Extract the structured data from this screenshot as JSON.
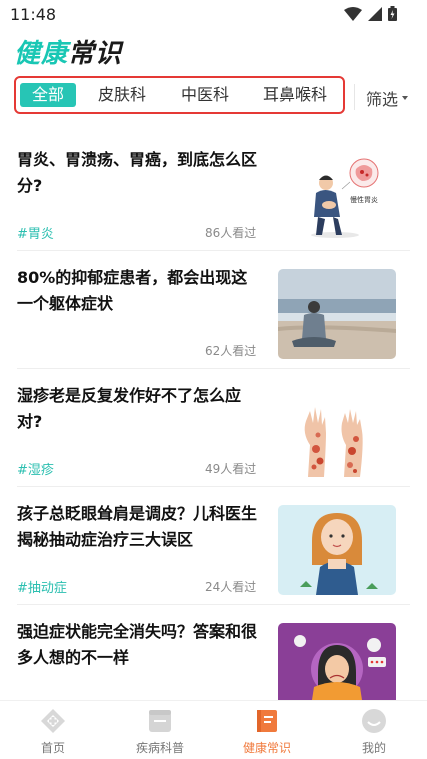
{
  "status_bar": {
    "time": "11:48"
  },
  "header": {
    "title_part1": "健康",
    "title_part2": "常识"
  },
  "tabs": [
    {
      "label": "全部",
      "active": true
    },
    {
      "label": "皮肤科",
      "active": false
    },
    {
      "label": "中医科",
      "active": false
    },
    {
      "label": "耳鼻喉科",
      "active": false
    }
  ],
  "filter": {
    "label": "筛选"
  },
  "articles": [
    {
      "title": "胃炎、胃溃疡、胃癌，到底怎么区分?",
      "tag": "#胃炎",
      "views": "86人看过",
      "thumb_text": "慢性胃炎"
    },
    {
      "title": "80%的抑郁症患者，都会出现这一个躯体症状",
      "tag": "",
      "views": "62人看过"
    },
    {
      "title": "湿疹老是反复发作好不了怎么应对?",
      "tag": "#湿疹",
      "views": "49人看过"
    },
    {
      "title": "孩子总眨眼耸肩是调皮？儿科医生揭秘抽动症治疗三大误区",
      "tag": "#抽动症",
      "views": "24人看过"
    },
    {
      "title": "强迫症状能完全消失吗？答案和很多人想的不一样",
      "tag": "",
      "views": ""
    }
  ],
  "bottom_nav": [
    {
      "label": "首页",
      "icon": "home-icon",
      "active": false
    },
    {
      "label": "疾病科普",
      "icon": "disease-book-icon",
      "active": false
    },
    {
      "label": "健康常识",
      "icon": "health-tips-icon",
      "active": true
    },
    {
      "label": "我的",
      "icon": "profile-icon",
      "active": false
    }
  ],
  "colors": {
    "accent": "#27c5b5",
    "highlight_border": "#e53935",
    "nav_active": "#f07a3d"
  }
}
